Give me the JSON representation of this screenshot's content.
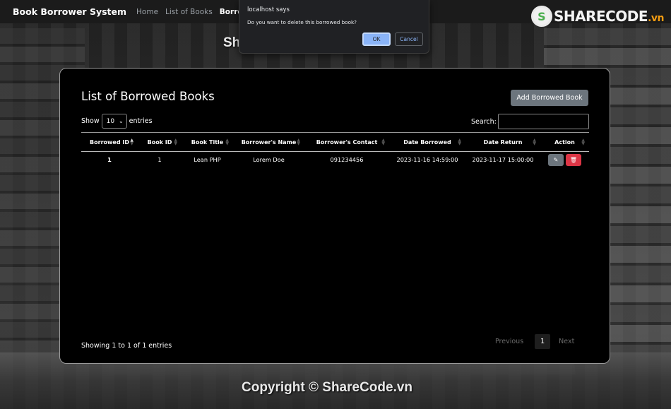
{
  "navbar": {
    "brand": "Book Borrower System",
    "links": [
      "Home",
      "List of Books",
      "Borrowed"
    ]
  },
  "logo": {
    "mark": "S",
    "text": "SHARECODE",
    "tld": ".vn"
  },
  "watermark": {
    "top": "ShareCode.vn",
    "bottom": "Copyright © ShareCode.vn"
  },
  "dialog": {
    "title": "localhost says",
    "message": "Do you want to delete this borrowed book?",
    "ok_label": "OK",
    "cancel_label": "Cancel"
  },
  "panel": {
    "title": "List of Borrowed Books",
    "add_button": "Add Borrowed Book",
    "show_label": "Show",
    "entries_value": "10",
    "entries_label": "entries",
    "search_label": "Search:",
    "search_value": ""
  },
  "table": {
    "headers": [
      "Borrowed ID",
      "Book ID",
      "Book Title",
      "Borrower's Name",
      "Borrower's Contact",
      "Date Borrowed",
      "Date Return",
      "Action"
    ],
    "rows": [
      [
        "1",
        "1",
        "Lean PHP",
        "Lorem Doe",
        "091234456",
        "2023-11-16 14:59:00",
        "2023-11-17 15:00:00"
      ]
    ]
  },
  "footer": {
    "info": "Showing 1 to 1 of 1 entries",
    "previous": "Previous",
    "page": "1",
    "next": "Next"
  },
  "icons": {
    "edit": "pencil-icon",
    "delete": "trash-icon",
    "dropdown": "chevron-down-icon",
    "sort": "sort-icon"
  },
  "colors": {
    "navbar_bg": "#1b1b1b",
    "panel_bg": "#000000",
    "secondary": "#6c757d",
    "danger": "#dc3545",
    "dialog_ok": "#8ab4f8"
  }
}
